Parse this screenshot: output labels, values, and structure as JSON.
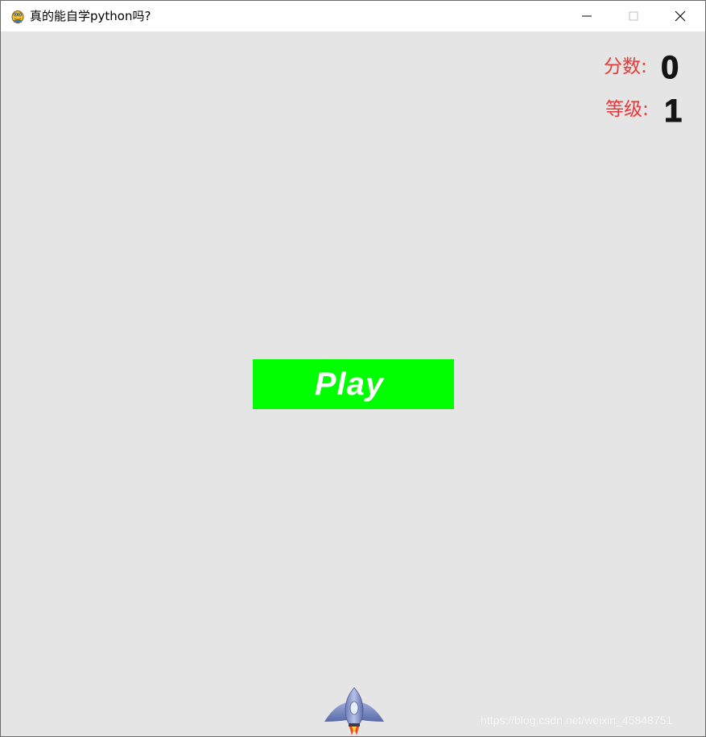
{
  "window": {
    "title": "真的能自学python吗?",
    "icon": "pygame-snake-icon",
    "controls": [
      "minimize-icon",
      "maximize-icon",
      "close-icon"
    ]
  },
  "hud": {
    "score_label": "分数:",
    "score_value": "0",
    "level_label": "等级:",
    "level_value": "1"
  },
  "play_button": {
    "label": "Play"
  },
  "player": {
    "sprite": "rocket-ship-icon"
  },
  "watermark": "https://blog.csdn.net/weixin_45848751",
  "colors": {
    "background": "#e5e5e5",
    "hud_label": "#e63a3a",
    "hud_value": "#151515",
    "play_button_bg": "#00ff00",
    "play_button_text": "#ffffff"
  }
}
